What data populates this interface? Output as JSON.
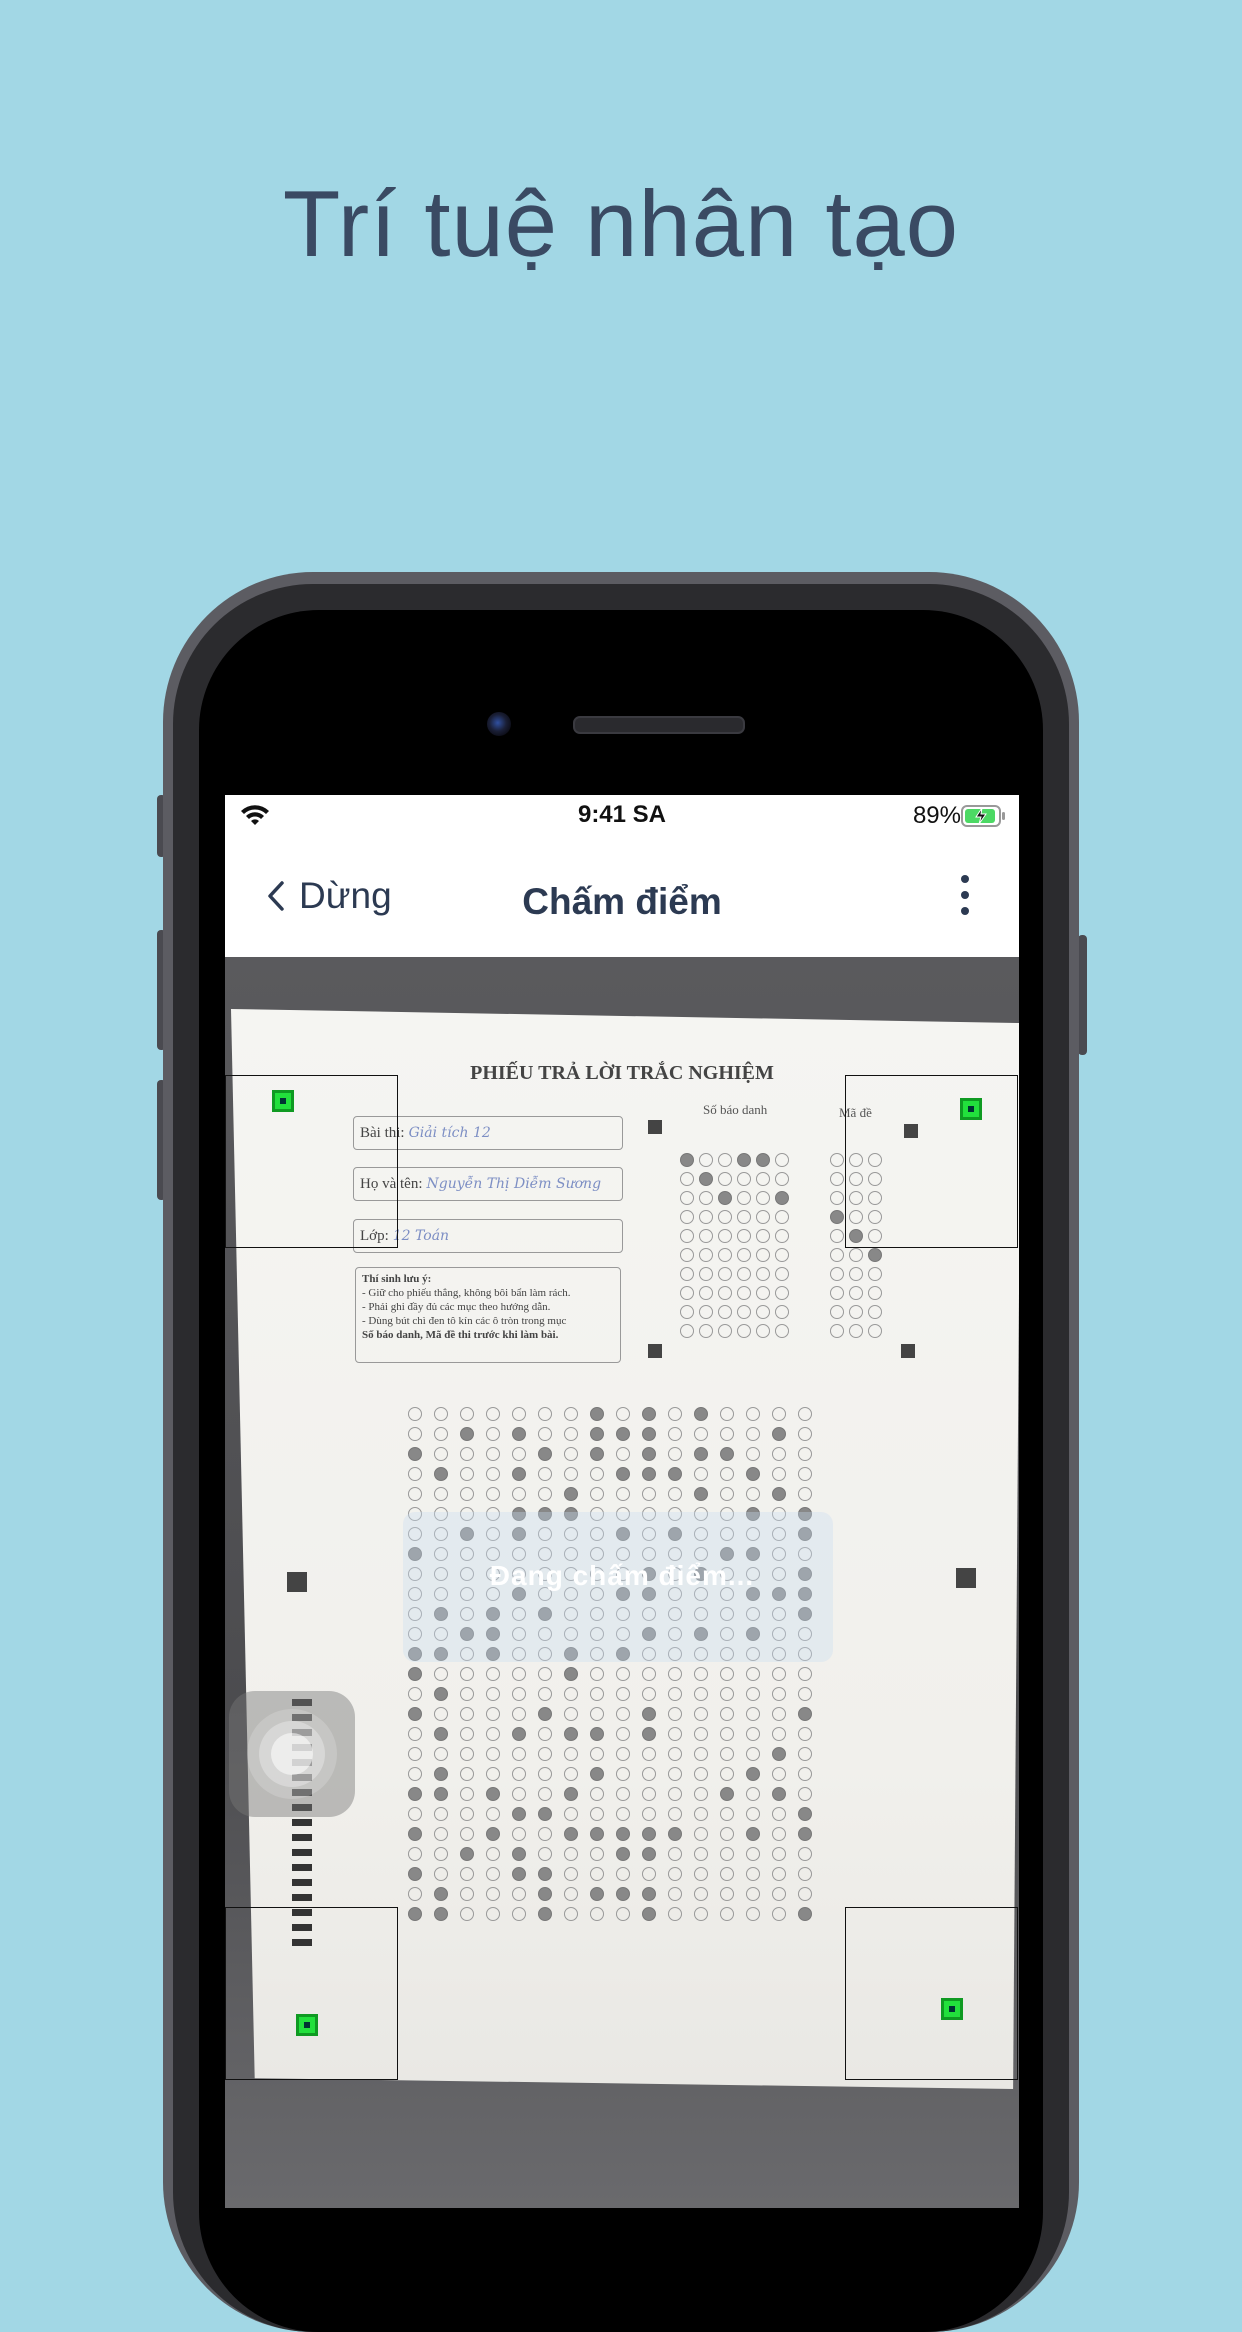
{
  "headline": "Trí tuệ nhân tạo",
  "status_bar": {
    "time": "9:41 SA",
    "battery": "89%"
  },
  "nav": {
    "back_label": "Dừng",
    "title": "Chấm điểm"
  },
  "sheet": {
    "title": "PHIẾU TRẢ LỜI TRẮC NGHIỆM",
    "field_exam": "Bài thi:",
    "field_exam_value": "Giải tích 12",
    "field_name": "Họ và tên:",
    "field_name_value": "Nguyễn Thị Diễm Sương",
    "field_class": "Lớp:",
    "field_class_value": "12 Toán",
    "note_title": "Thí sinh lưu ý:",
    "note_1": "- Giữ cho phiếu thẳng, không bôi bẩn làm rách.",
    "note_2": "- Phải ghi đầy đủ các mục theo hướng dẫn.",
    "note_3": "- Dùng bút chì đen tô kín các ô tròn trong mục",
    "note_4": "Số báo danh, Mã đề thi trước khi làm bài.",
    "student_id_label": "Số báo danh",
    "exam_code_label": "Mã đề"
  },
  "overlay": {
    "status": "Đang chấm điểm..."
  },
  "colors": {
    "background": "#a2d7e5",
    "marker": "#22e03c",
    "text": "#3a4a63"
  }
}
